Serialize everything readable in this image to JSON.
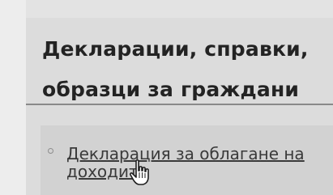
{
  "section": {
    "title": "Декларации, справки, образци за граждани"
  },
  "documents": {
    "items": [
      {
        "label": "Декларация за облагане на доходите"
      }
    ]
  },
  "icons": {
    "bullet": "hollow-circle-bullet",
    "cursor": "hand-pointer-icon"
  },
  "colors": {
    "heading": "#232323",
    "link": "#3a3a3a",
    "divider": "#8a8a8a"
  }
}
